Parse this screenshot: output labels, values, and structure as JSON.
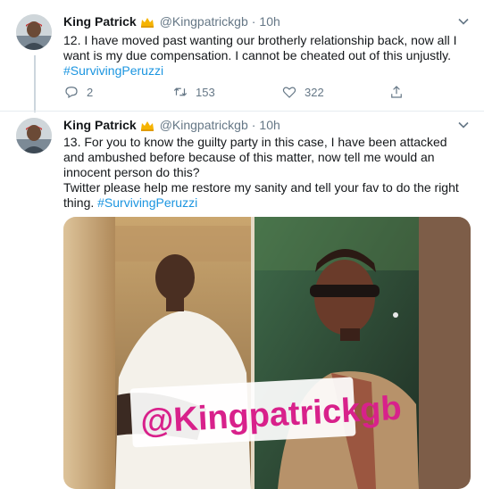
{
  "tweets": [
    {
      "name": "King Patrick",
      "handle": "@Kingpatrickgb",
      "dot": "·",
      "time": "10h",
      "line1": "12. I have moved past wanting our brotherly relationship back, now all I want is my due compensation. I cannot be cheated out of this unjustly.",
      "hashtag": "#SurvivingPeruzzi",
      "replies": "2",
      "retweets": "153",
      "likes": "322"
    },
    {
      "name": "King Patrick",
      "handle": "@Kingpatrickgb",
      "dot": "·",
      "time": "10h",
      "line1": "13. For you to know the guilty party in this case, I have been attacked and ambushed before because of this matter, now tell me would an innocent person do this?",
      "line2": "Twitter please help me restore my sanity and tell your fav to do the right thing.",
      "hashtag": "#SurvivingPeruzzi",
      "watermark": "@Kingpatrickgb"
    }
  ],
  "colors": {
    "link": "#1b95e0",
    "secondary": "#657786",
    "crown": "#f5b301",
    "watermark_text": "#d8218b",
    "watermark_bg": "#ffffff"
  },
  "icons": [
    "crown-icon",
    "chevron-down-icon",
    "reply-icon",
    "retweet-icon",
    "like-icon",
    "share-icon"
  ]
}
